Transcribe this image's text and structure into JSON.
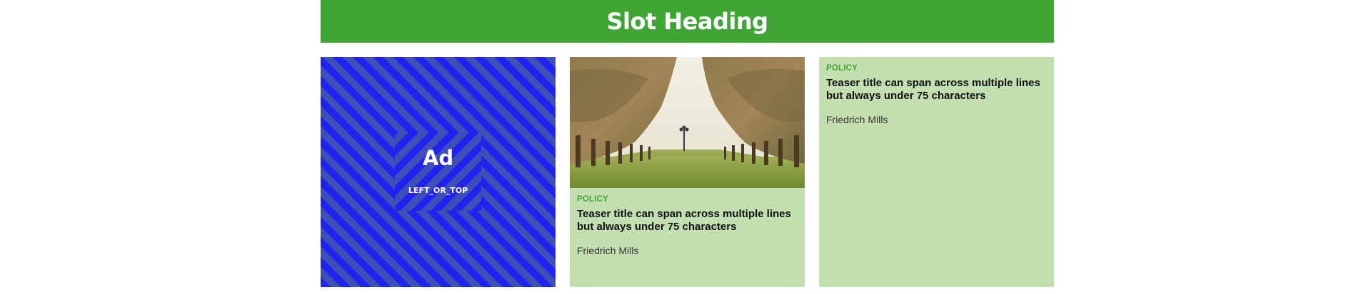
{
  "slot": {
    "heading": "Slot Heading"
  },
  "ad": {
    "label": "Ad",
    "position": "LEFT_OR_TOP"
  },
  "teasers": [
    {
      "image": "palm-tree-avenue-photo",
      "tag": "POLICY",
      "title": "Teaser title can span across multiple lines but always under 75 characters",
      "author": "Friedrich Mills"
    },
    {
      "tag": "POLICY",
      "title": "Teaser title can span across multiple lines but always under 75 characters",
      "author": "Friedrich Mills"
    }
  ],
  "colors": {
    "brand_green": "#3fa535",
    "teaser_bg": "#c3dfb0",
    "ad_blue": "#2222ee",
    "ad_stripe": "#3e4fb8"
  }
}
